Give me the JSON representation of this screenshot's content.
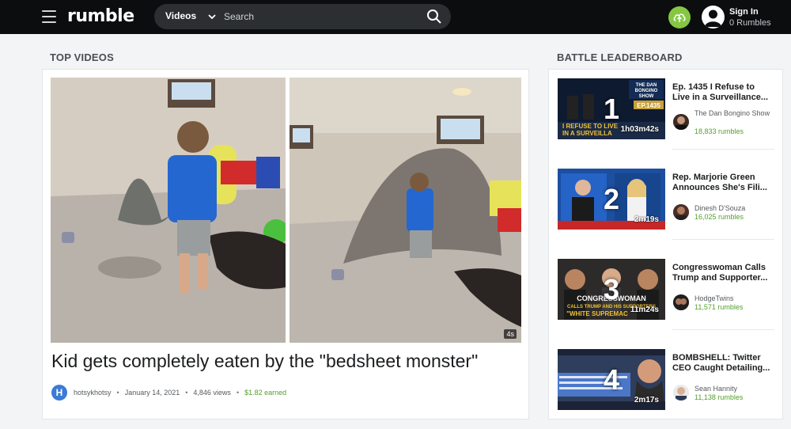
{
  "header": {
    "logo": "rumble",
    "search_category": "Videos",
    "search_placeholder": "Search",
    "signin_label": "Sign In",
    "rumbles_label": "0 Rumbles"
  },
  "top_videos": {
    "heading": "TOP VIDEOS",
    "featured": {
      "title": "Kid gets completely eaten by the \"bedsheet monster\"",
      "duration": "4s",
      "channel_initial": "H",
      "channel": "hotsykhotsy",
      "date": "January 14, 2021",
      "views": "4,846 views",
      "earned": "$1.82 earned",
      "separator": "•"
    }
  },
  "leaderboard": {
    "heading": "BATTLE LEADERBOARD",
    "items": [
      {
        "rank": "1",
        "duration": "1h03m42s",
        "title_line1": "Ep. 1435 I Refuse to",
        "title_line2": "Live in a Surveillance...",
        "author": "The Dan Bongino Show",
        "rumbles": "18,833 rumbles",
        "thumb_text_top": "THE DAN BONGINO SHOW",
        "thumb_text_ep": "EP.1435",
        "thumb_text_bottom": "I REFUSE TO LIVE IN A SURVEILLA"
      },
      {
        "rank": "2",
        "duration": "2m19s",
        "title_line1": "Rep. Marjorie Green",
        "title_line2": "Announces She's Fili...",
        "author": "Dinesh D'Souza",
        "rumbles": "16,025 rumbles"
      },
      {
        "rank": "3",
        "duration": "11m24s",
        "title_line1": "Congresswoman Calls",
        "title_line2": "Trump and Supporter...",
        "author": "HodgeTwins",
        "rumbles": "11,571 rumbles",
        "thumb_text_bottom": "CONGRESSWOMAN CALLS TRUMP AND HIS SUPPORTERS WHITE SUPREMAC"
      },
      {
        "rank": "4",
        "duration": "2m17s",
        "title_line1": "BOMBSHELL: Twitter",
        "title_line2": "CEO Caught Detailing...",
        "author": "Sean Hannity",
        "rumbles": "11,138 rumbles"
      }
    ]
  },
  "colors": {
    "header_bg": "#0b0d0e",
    "brand_green": "#85c742",
    "earned_green": "#55a02c",
    "page_bg": "#f3f4f5"
  },
  "icons": [
    "hamburger-icon",
    "chevron-down-icon",
    "search-icon",
    "upload-icon",
    "user-icon"
  ]
}
